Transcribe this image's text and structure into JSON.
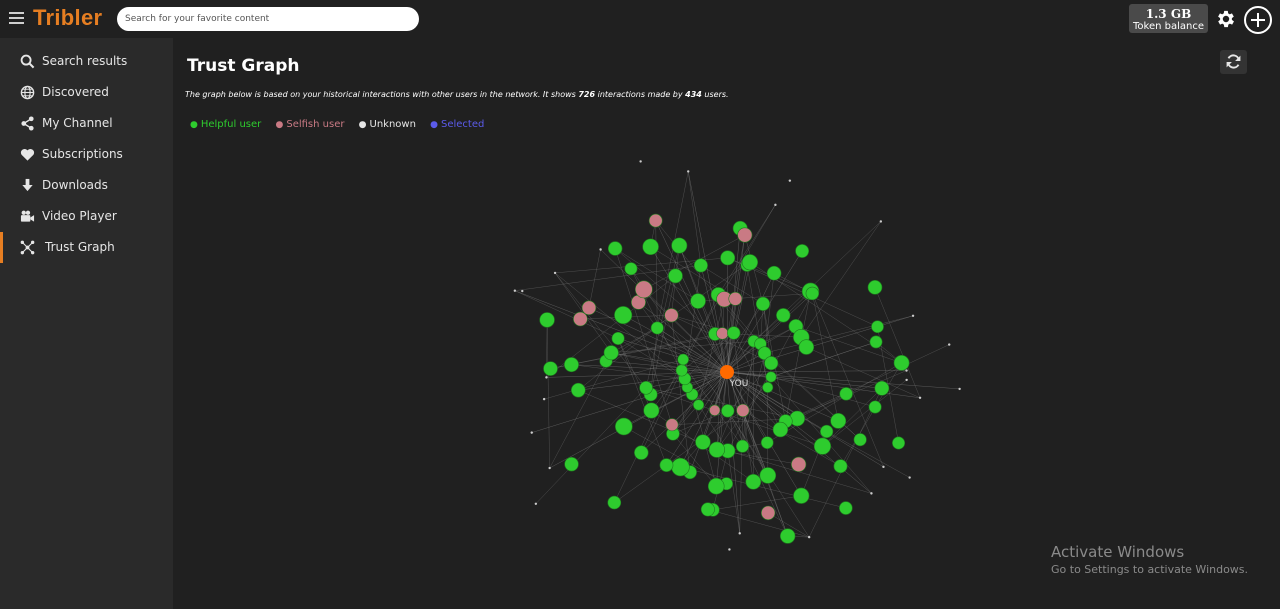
{
  "app": {
    "title": "Tribler",
    "accent_color": "#e67e22"
  },
  "search": {
    "placeholder": "Search for your favorite content"
  },
  "token_balance": {
    "amount": "1.3 GB",
    "label": "Token balance"
  },
  "header_icons": [
    "menu-icon",
    "gear-icon",
    "add-circle-icon"
  ],
  "sidebar": {
    "items": [
      {
        "label": "Search results",
        "icon": "search-icon",
        "active": false
      },
      {
        "label": "Discovered",
        "icon": "globe-icon",
        "active": false
      },
      {
        "label": "My Channel",
        "icon": "share-icon",
        "active": false
      },
      {
        "label": "Subscriptions",
        "icon": "heart-icon",
        "active": false
      },
      {
        "label": "Downloads",
        "icon": "download-icon",
        "active": false
      },
      {
        "label": "Video Player",
        "icon": "video-camera-icon",
        "active": false
      },
      {
        "label": "Trust Graph",
        "icon": "graph-icon",
        "active": true
      }
    ]
  },
  "main": {
    "title": "Trust Graph",
    "refresh_icon": "refresh-icon",
    "description": {
      "prefix": "The graph below is based on your historical interactions with other users in the network. It shows ",
      "interactions": "726",
      "middle": " interactions made by ",
      "users": "434",
      "suffix": " users."
    },
    "legend": [
      {
        "label": "Helpful user",
        "color": "#2ecc2e"
      },
      {
        "label": "Selfish user",
        "color": "#c97a84"
      },
      {
        "label": "Unknown",
        "color": "#e6e6e6"
      },
      {
        "label": "Selected",
        "color": "#5b5bea"
      }
    ],
    "graph": {
      "center_label": "YOU",
      "center_color": "#ff6a00",
      "helpful_color": "#2ecc2e",
      "selfish_color": "#c97a84",
      "unknown_color": "#cccccc",
      "edge_color": "#888888"
    }
  },
  "watermark": {
    "title": "Activate Windows",
    "subtitle": "Go to Settings to activate Windows."
  }
}
